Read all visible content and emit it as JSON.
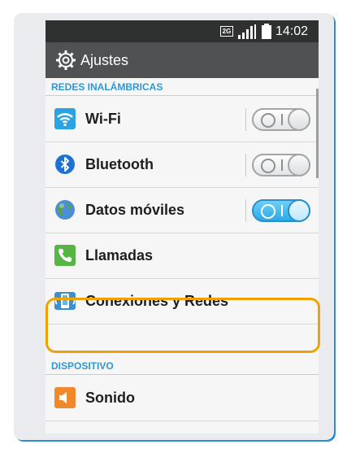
{
  "status_bar": {
    "network_badge": "2G",
    "time": "14:02"
  },
  "action_bar": {
    "title": "Ajustes",
    "icon": "gear-icon"
  },
  "sections": [
    {
      "header": "REDES INALÁMBRICAS",
      "items": [
        {
          "label": "Wi-Fi",
          "icon": "wifi-icon",
          "toggle": "off"
        },
        {
          "label": "Bluetooth",
          "icon": "bluetooth-icon",
          "toggle": "off"
        },
        {
          "label": "Datos móviles",
          "icon": "globe-icon",
          "toggle": "on"
        },
        {
          "label": "Llamadas",
          "icon": "phone-icon"
        },
        {
          "label": "Conexiones y Redes",
          "icon": "connections-icon",
          "highlighted": true
        }
      ]
    },
    {
      "header": "DISPOSITIVO",
      "items": [
        {
          "label": "Sonido",
          "icon": "speaker-icon"
        }
      ]
    }
  ],
  "colors": {
    "accent": "#2f97d3",
    "highlight": "#f0a300",
    "toggle_on": "#2da9e6"
  }
}
